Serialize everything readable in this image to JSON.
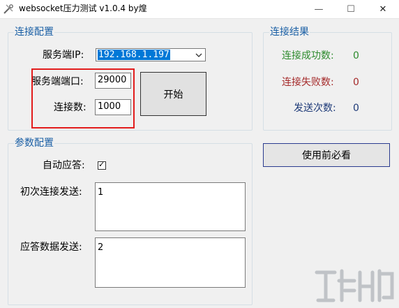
{
  "window": {
    "title": "websocket压力测试 v1.0.4 by煌",
    "icon": "tools-icon",
    "minimize_glyph": "—",
    "maximize_glyph": "☐",
    "close_glyph": "✕"
  },
  "connection": {
    "legend": "连接配置",
    "server_ip_label": "服务端IP:",
    "server_ip_value": "192.168.1.197",
    "server_port_label": "服务端端口:",
    "server_port_value": "29000",
    "conn_count_label": "连接数:",
    "conn_count_value": "1000",
    "start_button": "开始"
  },
  "results": {
    "legend": "连接结果",
    "success_label": "连接成功数:",
    "success_value": "0",
    "fail_label": "连接失败数:",
    "fail_value": "0",
    "sent_label": "发送次数:",
    "sent_value": "0",
    "colors": {
      "success": "#2e8b2e",
      "fail": "#a52a2a",
      "sent": "#1e3a78"
    }
  },
  "help_button": "使用前必看",
  "params": {
    "legend": "参数配置",
    "auto_reply_label": "自动应答:",
    "auto_reply_checked": true,
    "check_glyph": "✓",
    "initial_send_label": "初次连接发送:",
    "initial_send_value": "1",
    "reply_data_label": "应答数据发送:",
    "reply_data_value": "2"
  },
  "colors": {
    "legend": "#1a5fa5",
    "highlight": "#e21c1c",
    "selection": "#0078d7"
  }
}
